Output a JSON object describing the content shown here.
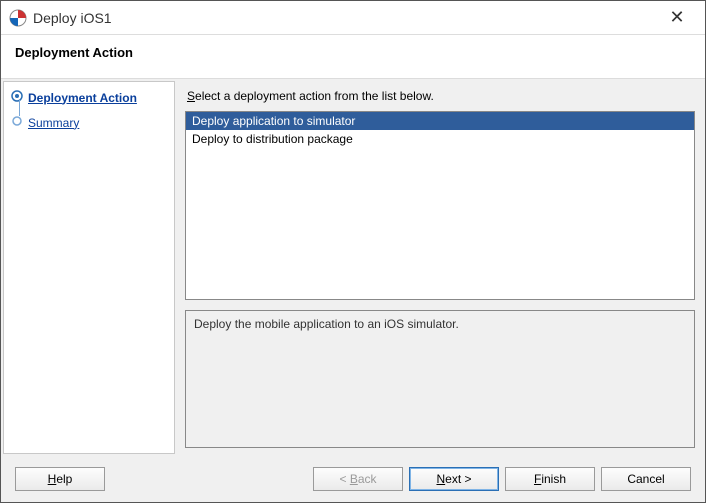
{
  "window": {
    "title": "Deploy iOS1",
    "close_glyph": "✕"
  },
  "header": {
    "title": "Deployment Action"
  },
  "sidebar": {
    "items": [
      {
        "label": "Deployment Action",
        "current": true
      },
      {
        "label": "Summary",
        "current": false
      }
    ]
  },
  "main": {
    "instruction_pre": "S",
    "instruction_rest": "elect a deployment action from the list below.",
    "options": [
      {
        "label": "Deploy application to simulator",
        "selected": true
      },
      {
        "label": "Deploy to distribution package",
        "selected": false
      }
    ],
    "description": "Deploy the mobile application to an iOS simulator."
  },
  "footer": {
    "help": {
      "u": "H",
      "rest": "elp"
    },
    "back": {
      "pre": "< ",
      "u": "B",
      "rest": "ack",
      "enabled": false
    },
    "next": {
      "u": "N",
      "rest": "ext >",
      "enabled": true,
      "default": true
    },
    "finish": {
      "u": "F",
      "rest": "inish",
      "enabled": true
    },
    "cancel": {
      "label": "Cancel",
      "enabled": true
    }
  }
}
